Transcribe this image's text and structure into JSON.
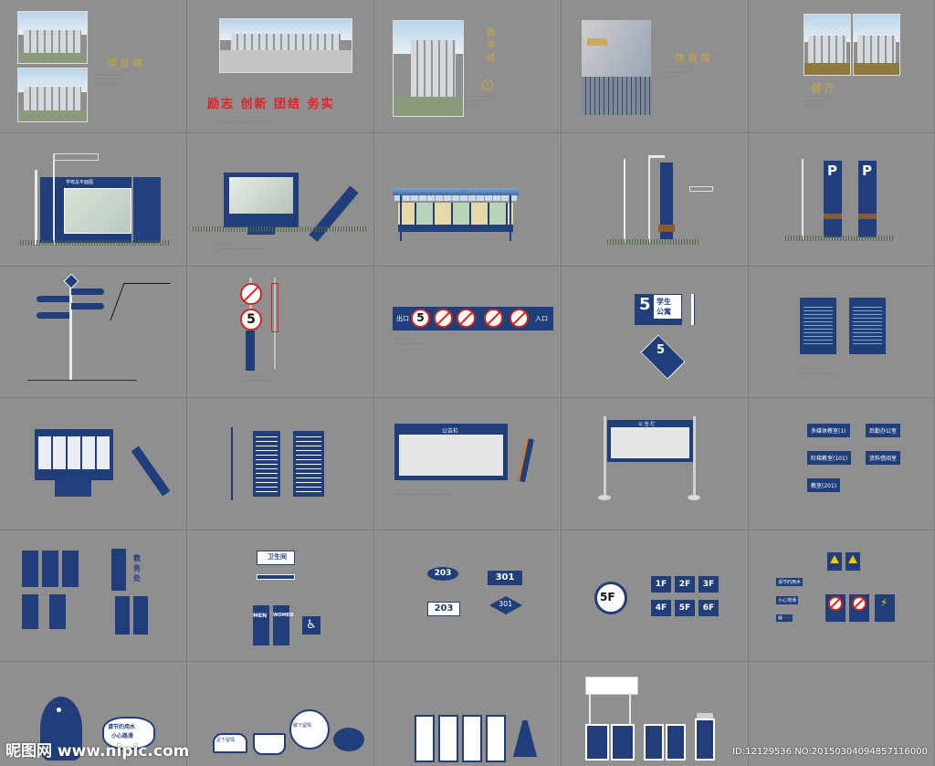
{
  "panels": {
    "p1_title": "综合楼",
    "p2_slogan": "励志  创新  团结  务实",
    "p3_title": "教学楼",
    "p3_num": "5",
    "p4_title": "体育馆",
    "p5_title": "餐厅"
  },
  "signs": {
    "campus_map_title": "学校总平面图",
    "parking_letter": "P",
    "exit_label": "出口",
    "entry_label": "入口",
    "speed_num": "5",
    "dorm_num": "5",
    "dorm_label_1": "学生",
    "dorm_label_2": "公寓",
    "notice_title": "公告栏",
    "bulletin_title": "公 告 栏",
    "room_multimedia_1": "多媒体教室(1)",
    "room_office": "后勤办公室",
    "room_class_101": "阶梯教室(101)",
    "room_library": "资料借阅室",
    "room_class_201": "教室(201)",
    "dept_affairs_1": "教",
    "dept_affairs_2": "务",
    "dept_affairs_3": "处",
    "toilet_label": "卫生间",
    "men_label": "MEN",
    "women_label": "WOMEN",
    "room_203": "203",
    "room_301": "301",
    "floor_5f": "5F",
    "floors": [
      "1F",
      "2F",
      "3F",
      "4F",
      "5F",
      "6F"
    ],
    "water_tip_1": "请节约用水",
    "water_tip_2": "小心地滑",
    "dolphin_tip_1": "请节约用水",
    "dolphin_tip_2": "小心路滑",
    "book_tip": "足下留情",
    "grass_tip": "脚下留情"
  },
  "watermark": {
    "left": "昵图网 www.nipic.com",
    "right": "ID:12129536 NO:20150304094857116000"
  }
}
